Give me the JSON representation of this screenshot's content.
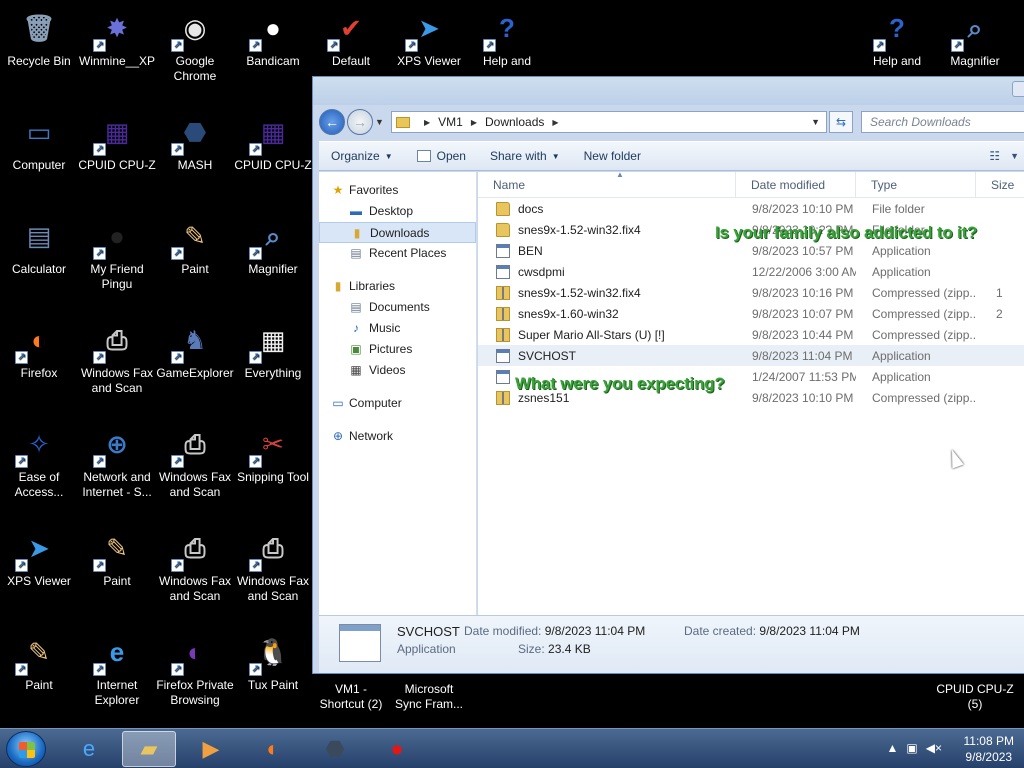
{
  "desktop": {
    "icons": [
      {
        "label": "Recycle Bin",
        "glyph": "🗑"
      },
      {
        "label": "Winmine__XP",
        "glyph": "✸"
      },
      {
        "label": "Google Chrome",
        "glyph": "◉"
      },
      {
        "label": "Bandicam",
        "glyph": "●"
      },
      {
        "label": "Default",
        "glyph": "✔"
      },
      {
        "label": "XPS Viewer",
        "glyph": "➤"
      },
      {
        "label": "Help and",
        "glyph": "?"
      },
      {
        "label": "Help and",
        "glyph": "?"
      },
      {
        "label": "Magnifier",
        "glyph": "⌕"
      },
      {
        "label": "Computer",
        "glyph": "▭"
      },
      {
        "label": "CPUID CPU-Z",
        "glyph": "▦"
      },
      {
        "label": "MASH",
        "glyph": "⬣"
      },
      {
        "label": "CPUID CPU-Z",
        "glyph": "▦"
      },
      {
        "label": "Calculator",
        "glyph": "▤"
      },
      {
        "label": "My Friend Pingu",
        "glyph": "●"
      },
      {
        "label": "Paint",
        "glyph": "✎"
      },
      {
        "label": "Magnifier",
        "glyph": "⌕"
      },
      {
        "label": "Firefox",
        "glyph": "◐"
      },
      {
        "label": "Windows Fax and Scan",
        "glyph": "⎙"
      },
      {
        "label": "GameExplorer",
        "glyph": "♞"
      },
      {
        "label": "Everything",
        "glyph": "▦"
      },
      {
        "label": "Ease of Access...",
        "glyph": "✧"
      },
      {
        "label": "Network and Internet - S...",
        "glyph": "⊕"
      },
      {
        "label": "Windows Fax and Scan",
        "glyph": "⎙"
      },
      {
        "label": "Snipping Tool",
        "glyph": "✂"
      },
      {
        "label": "XPS Viewer",
        "glyph": "➤"
      },
      {
        "label": "Paint",
        "glyph": "✎"
      },
      {
        "label": "Windows Fax and Scan",
        "glyph": "⎙"
      },
      {
        "label": "Windows Fax and Scan",
        "glyph": "⎙"
      },
      {
        "label": "Paint",
        "glyph": "✎"
      },
      {
        "label": "Internet Explorer",
        "glyph": "e"
      },
      {
        "label": "Firefox Private Browsing",
        "glyph": "◐"
      },
      {
        "label": "Tux Paint",
        "glyph": "🐧"
      },
      {
        "label": "VM1 - Shortcut (2)",
        "glyph": ""
      },
      {
        "label": "Microsoft Sync Fram...",
        "glyph": ""
      },
      {
        "label": "CPUID CPU-Z (5)",
        "glyph": ""
      }
    ]
  },
  "explorer": {
    "breadcrumb": [
      "VM1",
      "Downloads"
    ],
    "search_placeholder": "Search Downloads",
    "toolbar": {
      "organize": "Organize",
      "open": "Open",
      "share_with": "Share with",
      "new_folder": "New folder"
    },
    "nav": {
      "favorites": "Favorites",
      "desktop": "Desktop",
      "downloads": "Downloads",
      "recent_places": "Recent Places",
      "libraries": "Libraries",
      "documents": "Documents",
      "music": "Music",
      "pictures": "Pictures",
      "videos": "Videos",
      "computer": "Computer",
      "network": "Network"
    },
    "columns": {
      "name": "Name",
      "date": "Date modified",
      "type": "Type",
      "size": "Size"
    },
    "files": [
      {
        "name": "docs",
        "date": "9/8/2023 10:10 PM",
        "type": "File folder",
        "size": "",
        "kind": "folder"
      },
      {
        "name": "snes9x-1.52-win32.fix4",
        "date": "9/8/2023 10:?? PM",
        "type": "File folder",
        "size": "",
        "kind": "folder"
      },
      {
        "name": "BEN",
        "date": "9/8/2023 10:57 PM",
        "type": "Application",
        "size": "",
        "kind": "app"
      },
      {
        "name": "cwsdpmi",
        "date": "12/22/2006 3:00 AM",
        "type": "Application",
        "size": "",
        "kind": "app"
      },
      {
        "name": "snes9x-1.52-win32.fix4",
        "date": "9/8/2023 10:16 PM",
        "type": "Compressed (zipp...",
        "size": "1",
        "kind": "zip"
      },
      {
        "name": "snes9x-1.60-win32",
        "date": "9/8/2023 10:07 PM",
        "type": "Compressed (zipp...",
        "size": "2",
        "kind": "zip"
      },
      {
        "name": "Super Mario All-Stars (U) [!]",
        "date": "9/8/2023 10:44 PM",
        "type": "Compressed (zipp...",
        "size": "",
        "kind": "zip"
      },
      {
        "name": "SVCHOST",
        "date": "9/8/2023 11:04 PM",
        "type": "Application",
        "size": "",
        "kind": "app"
      },
      {
        "name": "",
        "date": "1/24/2007 11:53 PM",
        "type": "Application",
        "size": "",
        "kind": "app"
      },
      {
        "name": "zsnes151",
        "date": "9/8/2023 10:10 PM",
        "type": "Compressed (zipp...",
        "size": "",
        "kind": "zip"
      }
    ],
    "overlay_text_1": "Is your family also addicted to it?",
    "overlay_text_2": "What were you expecting?",
    "details": {
      "name": "SVCHOST",
      "type": "Application",
      "date_modified_label": "Date modified:",
      "date_modified": "9/8/2023 11:04 PM",
      "size_label": "Size:",
      "size": "23.4 KB",
      "date_created_label": "Date created:",
      "date_created": "9/8/2023 11:04 PM"
    }
  },
  "taskbar": {
    "time": "11:08 PM",
    "date": "9/8/2023"
  }
}
